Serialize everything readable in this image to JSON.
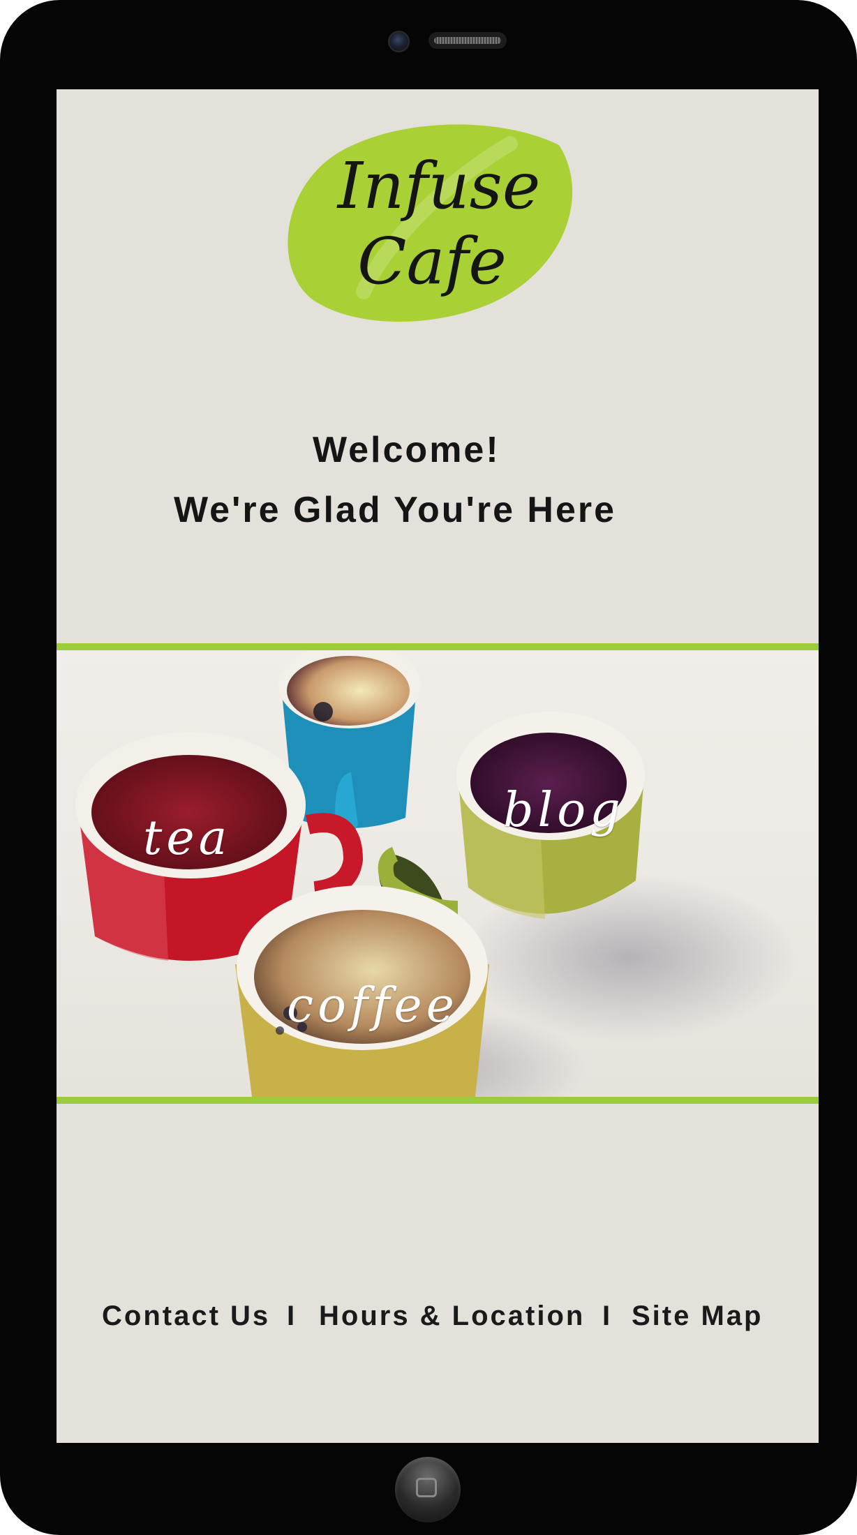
{
  "logo": {
    "line1": "Infuse",
    "line2": "Cafe",
    "leaf_color": "#a9d034"
  },
  "welcome": {
    "line1": "Welcome!",
    "line2": "We're Glad You're Here"
  },
  "hero": {
    "labels": {
      "tea": "tea",
      "blog": "blog",
      "coffee": "coffee"
    },
    "accent_color": "#9ccb3c"
  },
  "footer_nav": {
    "contact": "Contact Us",
    "separator": "I",
    "hours": "Hours & Location",
    "sitemap": "Site Map"
  },
  "icons": [
    "camera-icon",
    "speaker-icon",
    "home-button-icon"
  ]
}
